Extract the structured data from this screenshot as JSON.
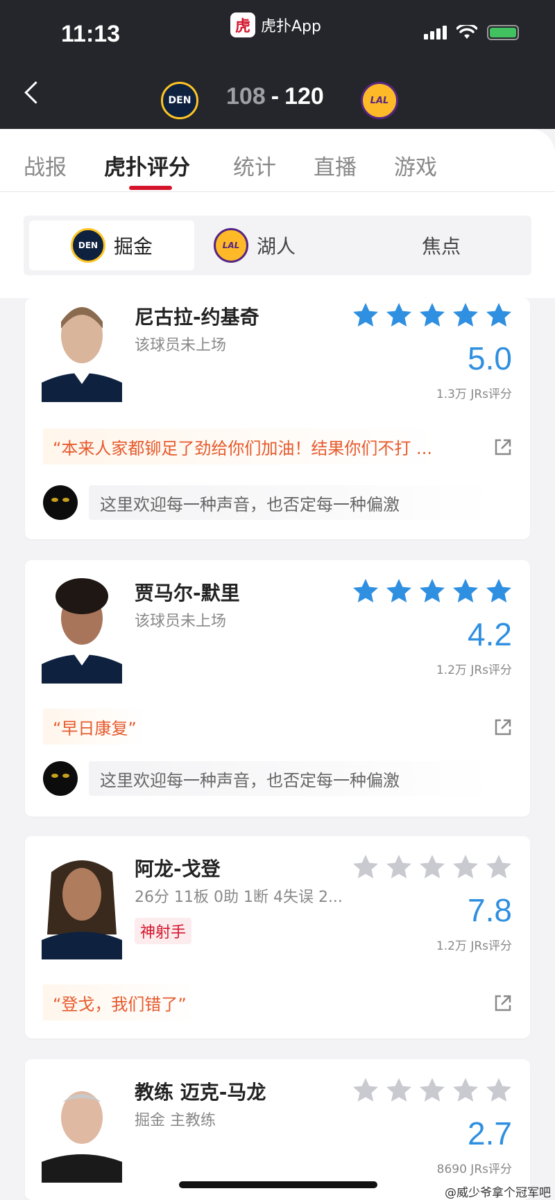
{
  "status_bar": {
    "time": "11:13",
    "app_label": "虎扑App",
    "app_logo": "虎扑"
  },
  "header": {
    "home_team_abbr": "DEN",
    "away_team_abbr": "LAL",
    "home_score": "108",
    "separator": "-",
    "away_score": "120"
  },
  "tabs": [
    {
      "label": "战报",
      "active": false
    },
    {
      "label": "虎扑评分",
      "active": true
    },
    {
      "label": "统计",
      "active": false
    },
    {
      "label": "直播",
      "active": false
    },
    {
      "label": "游戏",
      "active": false
    }
  ],
  "subnav": [
    {
      "label": "掘金",
      "logo": "DEN",
      "active": true
    },
    {
      "label": "湖人",
      "logo": "LAL",
      "active": false
    },
    {
      "label": "焦点",
      "active": false
    }
  ],
  "cards": [
    {
      "name": "尼古拉-约基奇",
      "info": "该球员未上场",
      "stars_filled": 5,
      "rating": "5.0",
      "raters": "1.3万 JRs评分",
      "quote": "“本来人家都铆足了劲给你们加油！结果你们不打 ...",
      "comment_placeholder": "这里欢迎每一种声音，也否定每一种偏激",
      "star_color": "#2f8fe0"
    },
    {
      "name": "贾马尔-默里",
      "info": "该球员未上场",
      "stars_filled": 5,
      "rating": "4.2",
      "raters": "1.2万 JRs评分",
      "quote": "“早日康复”",
      "comment_placeholder": "这里欢迎每一种声音，也否定每一种偏激",
      "star_color": "#2f8fe0"
    },
    {
      "name": "阿龙-戈登",
      "info": "26分 11板 0助 1断 4失误 2...",
      "tag": "神射手",
      "stars_filled": 0,
      "rating": "7.8",
      "raters": "1.2万 JRs评分",
      "quote": "“登戈，我们错了”"
    },
    {
      "name": "教练 迈克-马龙",
      "info": "掘金 主教练",
      "stars_filled": 0,
      "rating": "2.7",
      "raters": "8690 JRs评分"
    }
  ],
  "watermark": "@威少爷拿个冠军吧",
  "colors": {
    "accent": "#d4152b",
    "rating_blue": "#2f8fe0",
    "star_empty": "#c8cad0",
    "dark_bar": "#25262b"
  }
}
